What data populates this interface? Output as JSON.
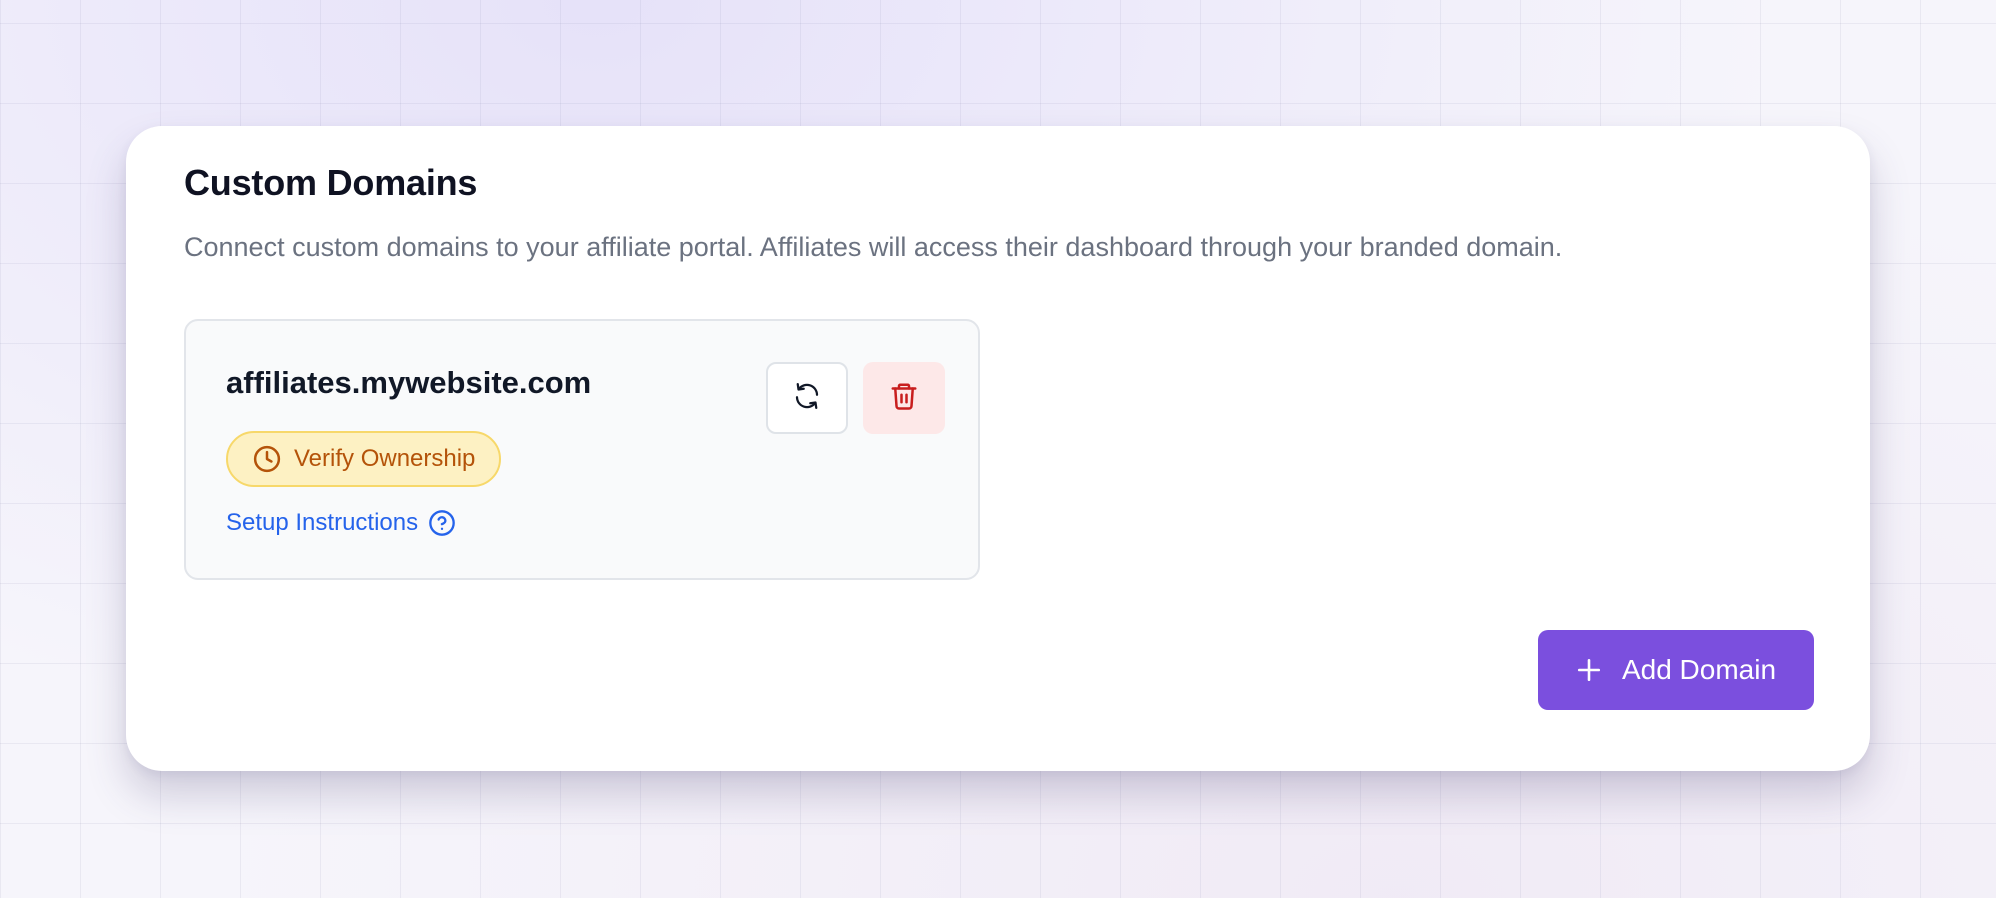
{
  "panel": {
    "title": "Custom Domains",
    "description": "Connect custom domains to your affiliate portal. Affiliates will access their dashboard through your branded domain."
  },
  "domains": [
    {
      "name": "affiliates.mywebsite.com",
      "status_label": "Verify Ownership",
      "status_icon": "clock-icon",
      "setup_link_label": "Setup Instructions",
      "setup_link_icon": "help-circle-icon",
      "actions": {
        "refresh_icon": "refresh-icon",
        "delete_icon": "trash-icon"
      }
    }
  ],
  "add_domain": {
    "label": "Add Domain",
    "icon": "plus-icon"
  },
  "colors": {
    "accent": "#7b4fde",
    "warning_bg": "#fdf1c3",
    "warning_text": "#b45309",
    "link": "#2563eb",
    "danger": "#c81e1e",
    "danger_bg": "#fde8e8"
  }
}
